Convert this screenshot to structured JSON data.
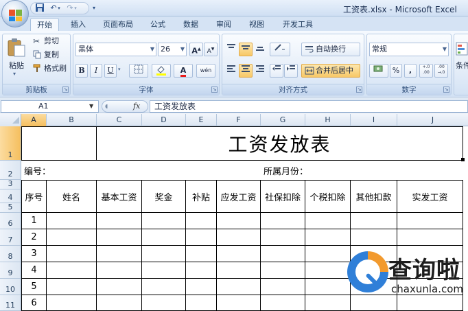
{
  "window": {
    "title": "工资表.xlsx - Microsoft Excel"
  },
  "quick_access": {
    "save_icon": "save-icon",
    "undo_icon": "undo-icon",
    "redo_icon": "redo-icon"
  },
  "tabs": [
    {
      "label": "开始",
      "active": true
    },
    {
      "label": "插入"
    },
    {
      "label": "页面布局"
    },
    {
      "label": "公式"
    },
    {
      "label": "数据"
    },
    {
      "label": "审阅"
    },
    {
      "label": "视图"
    },
    {
      "label": "开发工具"
    }
  ],
  "ribbon": {
    "clipboard": {
      "label": "剪贴板",
      "paste": "粘贴",
      "cut": "剪切",
      "copy": "复制",
      "format_painter": "格式刷"
    },
    "font": {
      "label": "字体",
      "name": "黑体",
      "size": "26",
      "bold": "B",
      "italic": "I",
      "underline": "U",
      "font_color_glyph": "A",
      "grow": "A",
      "shrink": "A",
      "phonetic": "wén"
    },
    "alignment": {
      "label": "对齐方式",
      "wrap_text": "自动换行",
      "merge_center": "合并后居中"
    },
    "number": {
      "label": "数字",
      "format": "常规",
      "percent": "%",
      "comma": ",",
      "inc_decimal": "+.0\n.00",
      "dec_decimal": ".00\n→.0"
    },
    "styles": {
      "partial_label": "条件"
    }
  },
  "formula_bar": {
    "name_box": "A1",
    "fx": "fx",
    "value": "工资发放表"
  },
  "columns": [
    "A",
    "B",
    "C",
    "D",
    "E",
    "F",
    "G",
    "H",
    "I",
    "J"
  ],
  "rows": [
    "1",
    "2",
    "3",
    "4",
    "5",
    "6",
    "7",
    "8",
    "9",
    "10",
    "11"
  ],
  "sheet": {
    "title": "工资发放表",
    "id_label": "编号：",
    "month_label": "所属月份：",
    "headers": [
      "序号",
      "姓名",
      "基本工资",
      "奖金",
      "补贴",
      "应发工资",
      "社保扣除",
      "个税扣除",
      "其他扣款",
      "实发工资"
    ],
    "serials": [
      "1",
      "2",
      "3",
      "4",
      "5",
      "6"
    ]
  },
  "watermark": {
    "brand": "查询啦",
    "url": "chaxunla.com"
  },
  "colors": {
    "ribbon_bg": "#dbe7f6",
    "selected_header": "#f7c867",
    "grid_border": "#000000"
  }
}
